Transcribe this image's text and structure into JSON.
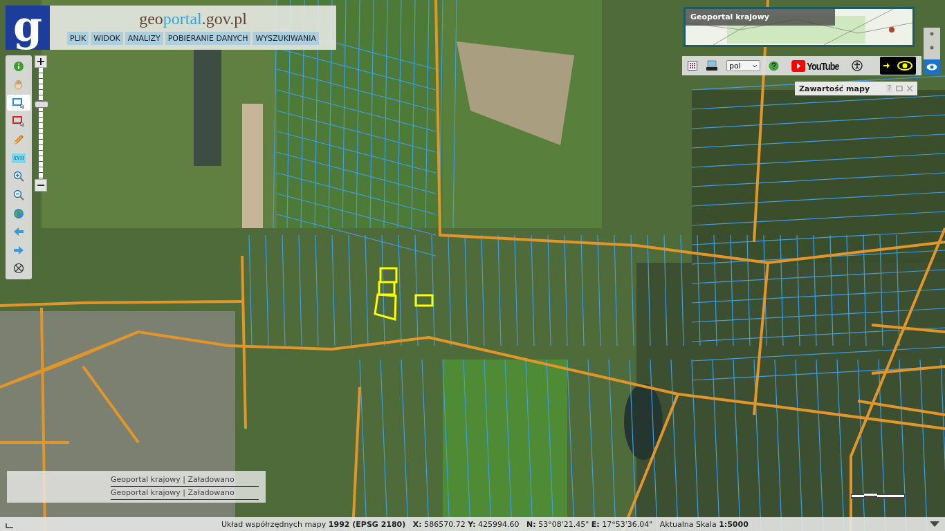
{
  "logo": {
    "mark": "g",
    "parts": [
      {
        "text": "geo",
        "kind": "brand"
      },
      {
        "text": "portal",
        "kind": "accent"
      },
      {
        "text": ".gov.pl",
        "kind": "brand"
      }
    ]
  },
  "menu": [
    "PLIK",
    "WIDOK",
    "ANALIZY",
    "POBIERANIE DANYCH",
    "WYSZUKIWANIA"
  ],
  "tools": [
    {
      "kind": "info",
      "selected": false
    },
    {
      "kind": "pan",
      "selected": false
    },
    {
      "kind": "select-blue",
      "selected": true
    },
    {
      "kind": "select-red",
      "selected": false
    },
    {
      "kind": "pencil",
      "selected": false
    },
    {
      "kind": "xyh",
      "label": "XYH",
      "selected": false
    },
    {
      "kind": "zoom-in",
      "selected": false
    },
    {
      "kind": "zoom-out",
      "selected": false
    },
    {
      "kind": "globe",
      "selected": false
    },
    {
      "kind": "back",
      "selected": false
    },
    {
      "kind": "forward",
      "selected": false
    },
    {
      "kind": "clear",
      "selected": false
    }
  ],
  "zoom": {
    "plus": "+",
    "minus": "−",
    "level": 0.67
  },
  "overview": {
    "title": "Geoportal krajowy"
  },
  "toolbar": {
    "language": "pol",
    "video": "YouTube",
    "high_contrast": {
      "on": true
    }
  },
  "map_content": {
    "title": "Zawartość mapy",
    "help": "?"
  },
  "log": [
    {
      "text": "Geoportal krajowy | Załadowano"
    },
    {
      "text": "Geoportal krajowy | Załadowano"
    }
  ],
  "status_bar": {
    "text": "Układ współrzędnych mapy **1992 (EPSG 2180)**   **X:** 586570.72 **Y:** 425994.60   **N:** 53°08'21.45\" **E:** 17°53'36.04\"   Aktualna Skala **1:5000**"
  }
}
